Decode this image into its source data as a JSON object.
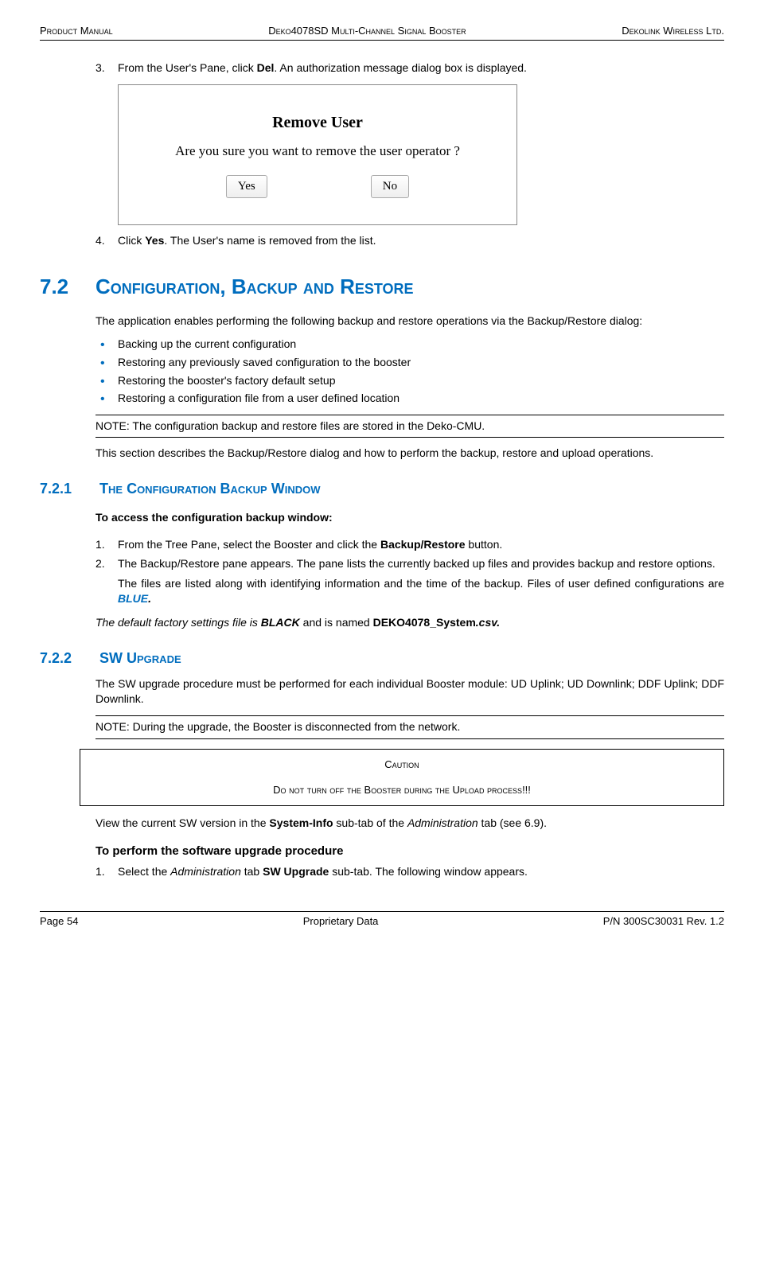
{
  "header": {
    "left": "Product Manual",
    "center": "Deko4078SD Multi-Channel Signal Booster",
    "right": "Dekolink Wireless Ltd."
  },
  "step3": {
    "num": "3.",
    "pre": "From the User's Pane, click ",
    "del": "Del",
    "post": ". An authorization message dialog box is displayed."
  },
  "dialog": {
    "title": "Remove User",
    "msg": "Are you sure you want to remove the user operator ?",
    "yes": "Yes",
    "no": "No"
  },
  "step4": {
    "num": "4.",
    "pre": "Click ",
    "yes": "Yes",
    "post": ". The User's name is removed from the list."
  },
  "sec72": {
    "num": "7.2",
    "title": "Configuration, Backup and Restore",
    "intro": "The application enables performing the following backup and restore operations via the Backup/Restore dialog:",
    "bullets": [
      "Backing up the current configuration",
      "Restoring any previously saved configuration to the booster",
      "Restoring the booster's factory default setup",
      "Restoring a configuration file from a user defined location"
    ],
    "note": "NOTE: The configuration backup and restore files are stored in the Deko-CMU.",
    "desc": "This section describes the Backup/Restore dialog and how to perform the backup, restore and upload operations."
  },
  "sec721": {
    "num": "7.2.1",
    "title": "The Configuration Backup Window",
    "access": "To access the configuration backup window",
    "s1": {
      "num": "1.",
      "pre": "From the Tree Pane, select the Booster and click the ",
      "btn": "Backup/Restore",
      "post": " button."
    },
    "s2": {
      "num": "2.",
      "text": "The Backup/Restore pane appears. The pane lists the currently backed up files and provides backup and restore options.",
      "sub_pre": "The files are listed along with identifying information and the time of the backup. Files of user defined configurations are ",
      "sub_blue": "BLUE",
      "sub_post": "."
    },
    "default": {
      "pre": "The default factory settings file is ",
      "black": "BLACK",
      "mid": " and is named ",
      "fname_a": "DEKO4078_System",
      "fname_b": ".csv."
    }
  },
  "sec722": {
    "num": "7.2.2",
    "title": "SW Upgrade",
    "intro": "The SW upgrade procedure must be performed for each individual Booster module: UD Uplink; UD Downlink; DDF Uplink; DDF Downlink.",
    "note": "NOTE: During the upgrade, the Booster is disconnected from the network.",
    "caution_title": "Caution",
    "caution_text": "Do not turn off the Booster during the Upload process!!!",
    "view": {
      "pre": "View the current SW version in the ",
      "sys": "System-Info",
      "mid": " sub-tab of the ",
      "admin": "Administration",
      "post": " tab (see 6.9)."
    },
    "proc_title": "To perform the software upgrade procedure",
    "s1": {
      "num": "1.",
      "pre": "Select the ",
      "admin": "Administration",
      "mid": " tab ",
      "sw": "SW Upgrade",
      "post": " sub-tab. The following window appears."
    }
  },
  "footer": {
    "left": "Page 54",
    "center": "Proprietary Data",
    "right": "P/N 300SC30031 Rev. 1.2"
  }
}
